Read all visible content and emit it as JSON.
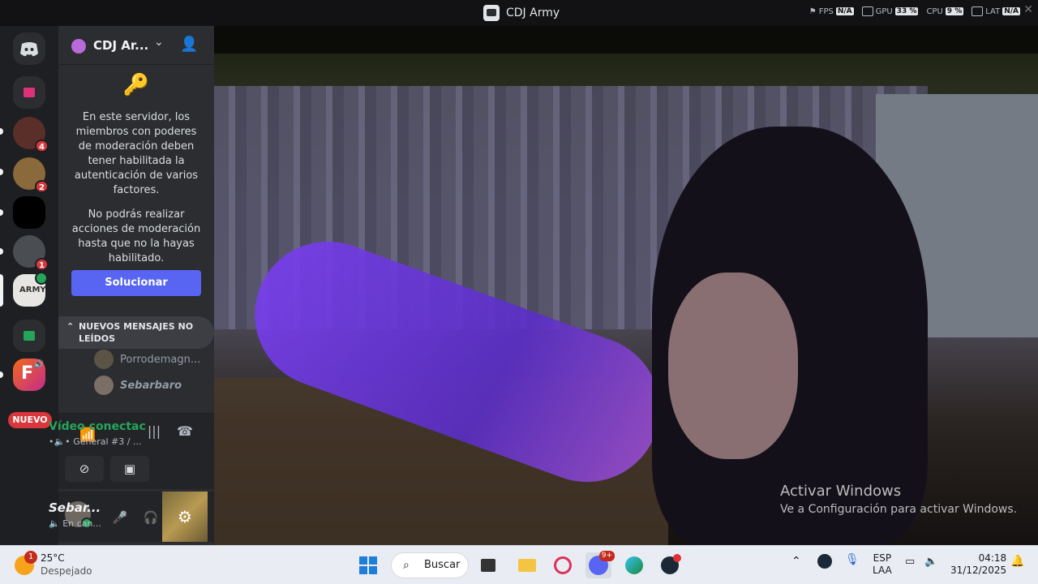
{
  "window": {
    "title": "CDJ Army",
    "stats": {
      "fps_label": "FPS",
      "fps_value": "N/A",
      "gpu_label": "GPU",
      "gpu_value": "33 %",
      "cpu_label": "CPU",
      "cpu_value": "9 %",
      "lat_label": "LAT",
      "lat_value": "N/A"
    }
  },
  "rail": {
    "badges": [
      "4",
      "2",
      "1"
    ],
    "nuevo_label": "NUEVO"
  },
  "server": {
    "name": "CDJ Ar...",
    "notice_p1": "En este servidor, los miembros con poderes de moderación deben tener habilitada la autenticación de varios factores.",
    "notice_p2": "No podrás realizar acciones de moderación hasta que no la hayas habilitado.",
    "solve_label": "Solucionar",
    "unread_label": "NUEVOS MENSAJES NO LEÍDOS",
    "members": [
      "Porrodemagn...",
      "Sebarbaro"
    ]
  },
  "voice": {
    "status": "Vídeo conectac",
    "channel": "General #3 / ..."
  },
  "user": {
    "name": "Sebar...",
    "status": "En can..."
  },
  "video": {
    "watermark_title": "Activar Windows",
    "watermark_sub": "Ve a Configuración para activar Windows."
  },
  "taskbar": {
    "weather_badge": "1",
    "temperature": "25°C",
    "condition": "Despejado",
    "search_label": "Buscar",
    "discord_badge": "9+",
    "lang_top": "ESP",
    "lang_bottom": "LAA",
    "time": "04:18",
    "date": "31/12/2025"
  },
  "colors": {
    "accent": "#5865f2",
    "connected": "#23a55a",
    "alert": "#da373c"
  }
}
